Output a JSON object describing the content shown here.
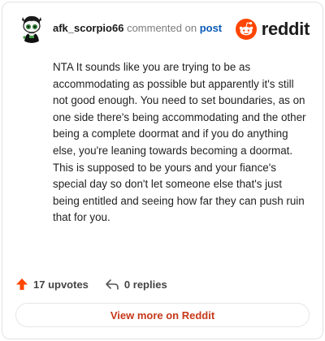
{
  "comment": {
    "username": "afk_scorpio66",
    "commented_label": "commented on",
    "post_link": "post",
    "text": "NTA It sounds like you are trying to be as accommodating as possible but apparently it's still not good enough. You need to set boundaries, as on one side there's being accommodating and the other being a complete doormat and if you do anything else, you're leaning towards becoming a doormat. This is supposed to be yours and your fiance's special day so don't let someone else that's just being entitled and seeing how far they can push ruin that for you."
  },
  "brand": {
    "name": "reddit",
    "accent": "#ff4500"
  },
  "footer": {
    "upvotes_label": "17 upvotes",
    "replies_label": "0 replies"
  },
  "view_more_label": "View more on Reddit",
  "colors": {
    "upvote_arrow": "#ff4500",
    "view_more_text": "#c7381a",
    "post_link": "#0a5ab8"
  },
  "icons": {
    "upvote": "upvote-arrow-icon",
    "reply": "reply-arrow-icon",
    "logo": "reddit-snoo-icon",
    "avatar": "snoo-avatar"
  }
}
